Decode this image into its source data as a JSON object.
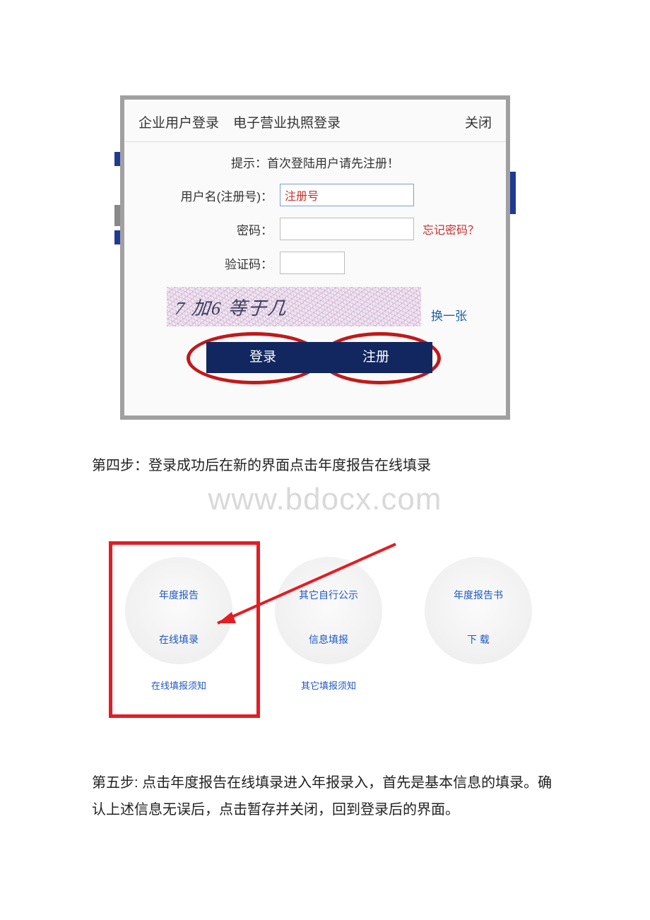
{
  "login": {
    "tab_user": "企业用户登录",
    "tab_license": "电子营业执照登录",
    "close": "关闭",
    "hint": "提示：首次登陆用户请先注册！",
    "label_username": "用户名(注册号)：",
    "placeholder_username": "注册号",
    "label_password": "密码：",
    "forgot": "忘记密码？",
    "label_captcha": "验证码：",
    "captcha_question": "7 加6 等于几",
    "captcha_refresh": "换一张",
    "btn_login": "登录",
    "btn_register": "注册"
  },
  "step4": "第四步：登录成功后在新的界面点击年度报告在线填录",
  "watermark": "www.bdocx.com",
  "options": {
    "opt1_line1": "年度报告",
    "opt1_line2": "在线填录",
    "opt1_sub": "在线填报须知",
    "opt2_line1": "其它自行公示",
    "opt2_line2": "信息填报",
    "opt2_sub": "其它填报须知",
    "opt3_line1": "年度报告书",
    "opt3_line2": "下 载"
  },
  "step5": "第五步: 点击年度报告在线填录进入年报录入，首先是基本信息的填录。确认上述信息无误后，点击暂存并关闭，回到登录后的界面。"
}
